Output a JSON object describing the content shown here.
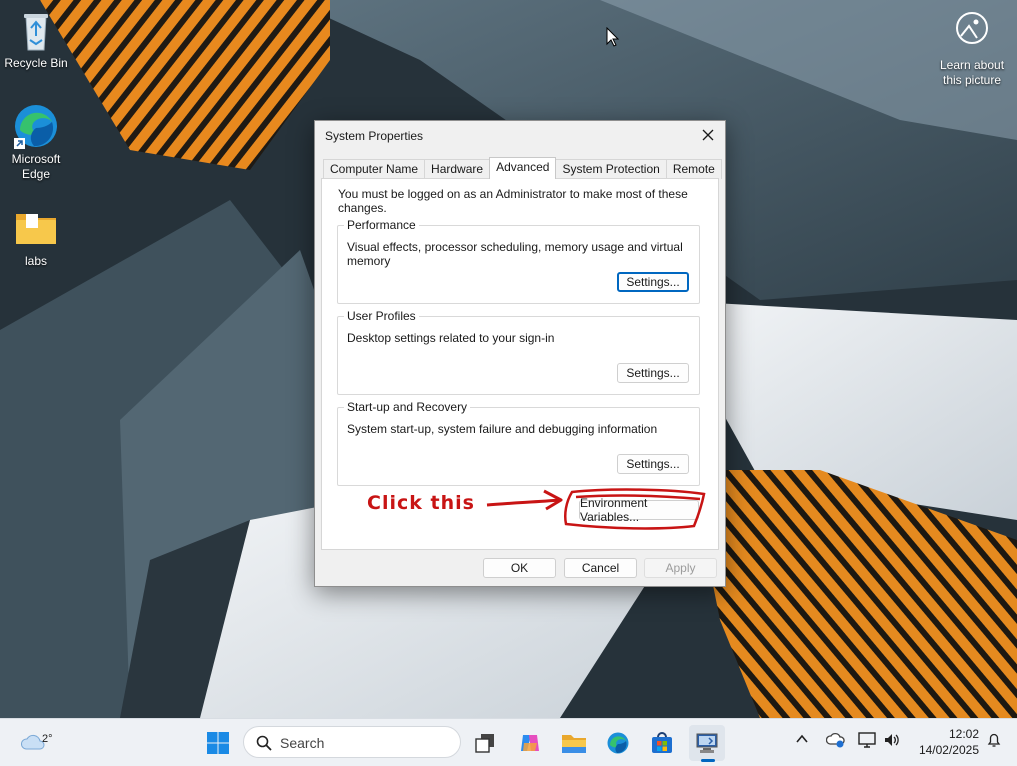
{
  "desktop": {
    "icons": [
      {
        "label": "Recycle Bin"
      },
      {
        "label": "Microsoft Edge"
      },
      {
        "label": "labs"
      }
    ],
    "learn_about": "Learn about this picture"
  },
  "dialog": {
    "title": "System Properties",
    "tabs": [
      "Computer Name",
      "Hardware",
      "Advanced",
      "System Protection",
      "Remote"
    ],
    "active_tab": "Advanced",
    "admin_note": "You must be logged on as an Administrator to make most of these changes.",
    "groups": [
      {
        "legend": "Performance",
        "description": "Visual effects, processor scheduling, memory usage and virtual memory",
        "button": "Settings..."
      },
      {
        "legend": "User Profiles",
        "description": "Desktop settings related to your sign-in",
        "button": "Settings..."
      },
      {
        "legend": "Start-up and Recovery",
        "description": "System start-up, system failure and debugging information",
        "button": "Settings..."
      }
    ],
    "env_button": "Environment Variables...",
    "ok": "OK",
    "cancel": "Cancel",
    "apply": "Apply"
  },
  "annotation": {
    "text": "Click this",
    "color": "#c81414"
  },
  "taskbar": {
    "weather_temp": "2°",
    "search_placeholder": "Search",
    "time": "12:02",
    "date": "14/02/2025",
    "accent": "#0067c0",
    "apps": [
      "start-icon",
      "task-view-icon",
      "copilot-icon",
      "file-explorer-icon",
      "edge-icon",
      "store-icon",
      "system-properties-icon"
    ]
  }
}
